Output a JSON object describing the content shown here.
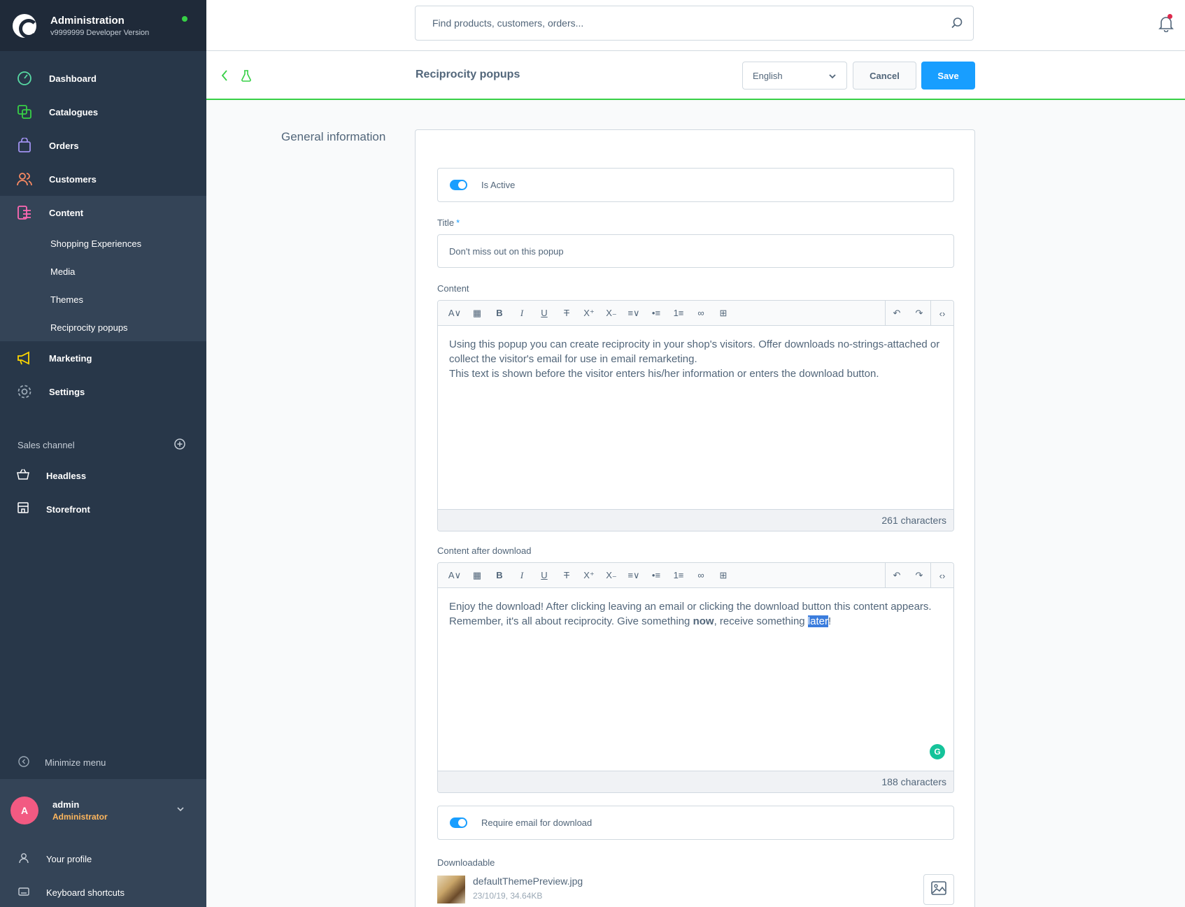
{
  "app": {
    "title": "Administration",
    "version": "v9999999 Developer Version"
  },
  "nav": {
    "dashboard": "Dashboard",
    "catalogues": "Catalogues",
    "orders": "Orders",
    "customers": "Customers",
    "content": "Content",
    "content_sub": [
      "Shopping Experiences",
      "Media",
      "Themes",
      "Reciprocity popups"
    ],
    "marketing": "Marketing",
    "settings": "Settings"
  },
  "sales_channel": {
    "heading": "Sales channel",
    "items": [
      "Headless",
      "Storefront"
    ]
  },
  "minimize_label": "Minimize menu",
  "user": {
    "initial": "A",
    "name": "admin",
    "role": "Administrator",
    "profile_link": "Your profile",
    "shortcuts_link": "Keyboard shortcuts"
  },
  "search": {
    "placeholder": "Find products, customers, orders..."
  },
  "smartbar": {
    "title": "Reciprocity popups",
    "language": "English",
    "cancel": "Cancel",
    "save": "Save"
  },
  "section": {
    "label": "General information"
  },
  "form": {
    "is_active_label": "Is Active",
    "is_active": true,
    "title_label": "Title",
    "title_required_mark": "*",
    "title_value": "Don't miss out on this popup",
    "content_label": "Content",
    "content_text_1": "Using this popup you can create reciprocity in your shop's visitors. Offer downloads no-strings-attached or collect the visitor's email for use in email remarketing.",
    "content_text_2": "This text is shown before the visitor enters his/her information or enters the download button.",
    "content_count": "261 characters",
    "after_label": "Content after download",
    "after_text_1": "Enjoy the download! After clicking leaving an email or clicking the download button this content appears.",
    "after_text_2a": "Remember, it's all about reciprocity. Give something ",
    "after_text_2b": "now",
    "after_text_2c": ", receive something ",
    "after_text_2d": "later",
    "after_text_2e": "!",
    "after_count": "188 characters",
    "require_email_label": "Require email for download",
    "require_email": true,
    "downloadable_label": "Downloadable",
    "file_name": "defaultThemePreview.jpg",
    "file_meta": "23/10/19, 34.64KB"
  },
  "colors": {
    "accent": "#189eff",
    "sidebar": "#283749",
    "success": "#37d046"
  }
}
